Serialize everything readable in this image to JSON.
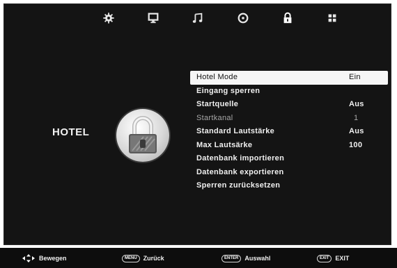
{
  "top_icons": [
    {
      "name": "gear-icon"
    },
    {
      "name": "monitor-icon"
    },
    {
      "name": "music-note-icon"
    },
    {
      "name": "clock-icon"
    },
    {
      "name": "lock-icon",
      "active": true
    },
    {
      "name": "grid-icon"
    }
  ],
  "section": {
    "title": "HOTEL"
  },
  "menu": {
    "items": [
      {
        "label": "Hotel Mode",
        "value": "Ein",
        "state": "selected"
      },
      {
        "label": "Eingang sperren",
        "value": ""
      },
      {
        "label": "Startquelle",
        "value": "Aus"
      },
      {
        "label": "Startkanal",
        "value": "1",
        "state": "dim"
      },
      {
        "label": "Standard Lautstärke",
        "value": "Aus"
      },
      {
        "label": "Max Lautsärke",
        "value": "100"
      },
      {
        "label": "Datenbank importieren",
        "value": ""
      },
      {
        "label": "Datenbank exportieren",
        "value": ""
      },
      {
        "label": "Sperren zurücksetzen",
        "value": ""
      }
    ]
  },
  "footer": {
    "move_label": "Bewegen",
    "menu_key": "MENU",
    "back_label": "Zurück",
    "enter_key": "ENTER",
    "select_label": "Auswahl",
    "exit_key": "EXIT",
    "exit_label": "EXIT"
  },
  "colors": {
    "panel_bg": "#141414",
    "highlight": "#f6f6f6",
    "text": "#f0f0f0"
  }
}
